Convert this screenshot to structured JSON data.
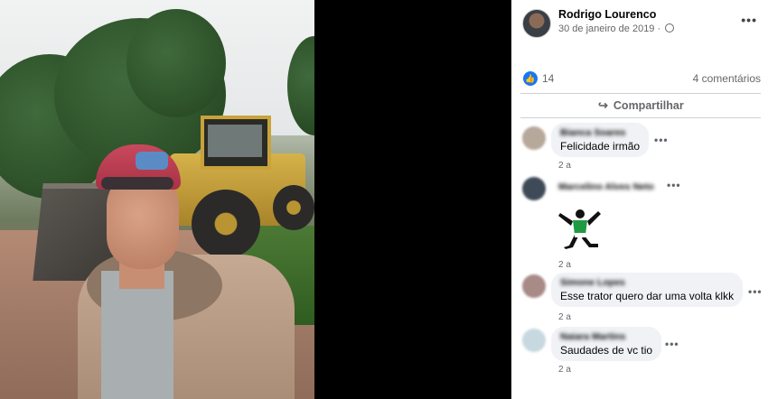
{
  "post": {
    "author": "Rodrigo Lourenco",
    "date": "30 de janeiro de 2019 ·",
    "privacy_icon": "globe-icon",
    "more_icon": "•••"
  },
  "reactions": {
    "like_icon": "👍",
    "like_count": "14",
    "comments_count": "4 comentários"
  },
  "actions": {
    "share_label": "Compartilhar",
    "share_icon": "↪"
  },
  "comments": [
    {
      "name": "Bianca Soares",
      "text": "Felicidade irmão",
      "time": "2 a",
      "more": "•••",
      "avatar_color": "#b6a89a"
    },
    {
      "name": "Marcelino Alves Neto",
      "text": "",
      "time": "2 a",
      "more": "•••",
      "avatar_color": "#3e4a57",
      "sticker": "soccer-player-sticker"
    },
    {
      "name": "Simone Lopes",
      "text": "Esse trator quero dar uma volta klkk",
      "time": "2 a",
      "more": "•••",
      "avatar_color": "#a88a86"
    },
    {
      "name": "Naiara Martins",
      "text": "Saudades de vc tio",
      "time": "2 a",
      "more": "•••",
      "avatar_color": "#c8d8e0"
    }
  ]
}
